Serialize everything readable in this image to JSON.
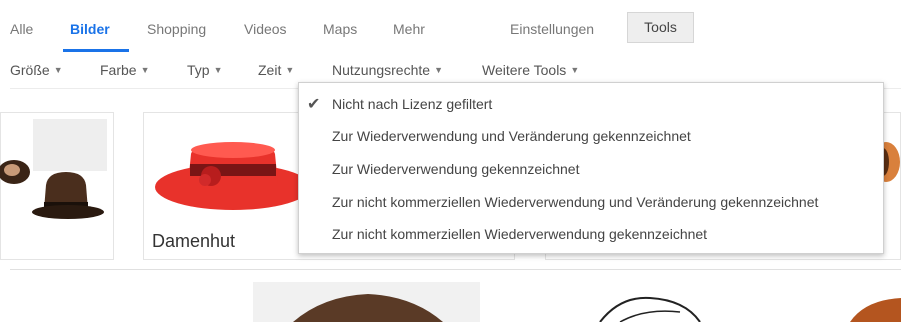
{
  "tabs": {
    "all": "Alle",
    "images": "Bilder",
    "shopping": "Shopping",
    "videos": "Videos",
    "maps": "Maps",
    "more": "Mehr",
    "settings": "Einstellungen",
    "tools": "Tools"
  },
  "filters": {
    "size": "Größe",
    "color": "Farbe",
    "type": "Typ",
    "time": "Zeit",
    "usage_rights": "Nutzungsrechte",
    "more_tools": "Weitere Tools",
    "caret": "▼"
  },
  "usage_rights_menu": {
    "check": "✔",
    "items": [
      "Nicht nach Lizenz gefiltert",
      "Zur Wiederverwendung und Veränderung gekennzeichnet",
      "Zur Wiederverwendung gekennzeichnet",
      "Zur nicht kommerziellen Wiederverwendung und Veränderung gekennzeichnet",
      "Zur nicht kommerziellen Wiederverwendung gekennzeichnet"
    ],
    "selected_index": 0
  },
  "results": {
    "card2_title": "Damenhut"
  },
  "colors": {
    "accent": "#1a73e8",
    "hat_red": "#e8322b",
    "hat_brown": "#4a2e1d"
  }
}
